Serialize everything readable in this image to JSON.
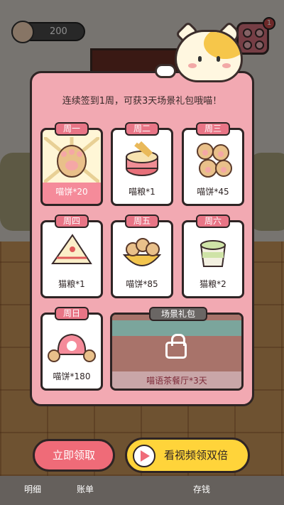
{
  "hud": {
    "coins": "200",
    "menu_badge": "1"
  },
  "dialog": {
    "heading": "连续签到1周，可获3天场景礼包哦喵！",
    "days": [
      {
        "day": "周一",
        "reward": "喵饼*20",
        "icon": "paw-biscuits-icon",
        "selected": true
      },
      {
        "day": "周二",
        "reward": "喵粮*1",
        "icon": "fish-can-icon",
        "selected": false
      },
      {
        "day": "周三",
        "reward": "喵饼*45",
        "icon": "paw-biscuits-icon",
        "selected": false
      },
      {
        "day": "周四",
        "reward": "猫粮*1",
        "icon": "snack-bag-icon",
        "selected": false
      },
      {
        "day": "周五",
        "reward": "喵饼*85",
        "icon": "biscuit-bowl-icon",
        "selected": false
      },
      {
        "day": "周六",
        "reward": "猫粮*2",
        "icon": "food-cup-icon",
        "selected": false
      },
      {
        "day": "周日",
        "reward": "喵饼*180",
        "icon": "gift-pouch-icon",
        "selected": false
      }
    ],
    "scene_gift": {
      "tag": "场景礼包",
      "reward": "喵语茶餐厅*3天"
    }
  },
  "buttons": {
    "claim": "立即领取",
    "double": "看视频领双倍"
  },
  "nav": {
    "details": "明细",
    "ledger": "账单",
    "savings": "存钱"
  }
}
